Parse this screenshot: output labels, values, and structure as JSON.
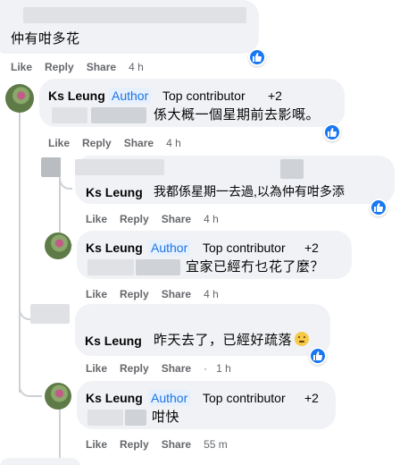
{
  "comment0": {
    "text": "仲有咁多花",
    "actions": {
      "like": "Like",
      "reply": "Reply",
      "share": "Share",
      "time": "4 h"
    }
  },
  "comment1": {
    "name": "Ks Leung",
    "author_badge": "Author",
    "contributor": "Top contributor",
    "plus": "+2",
    "text": "係大概一個星期前去影嘅。",
    "actions": {
      "like": "Like",
      "reply": "Reply",
      "share": "Share",
      "time": "4 h"
    }
  },
  "comment2": {
    "name": "Ks Leung",
    "text": "我都係星期一去過,以為仲有咁多添",
    "actions": {
      "like": "Like",
      "reply": "Reply",
      "share": "Share",
      "time": "4 h"
    }
  },
  "comment3": {
    "name": "Ks Leung",
    "author_badge": "Author",
    "contributor": "Top contributor",
    "plus": "+2",
    "text": "宜家已經冇乜花了麼？",
    "actions": {
      "like": "Like",
      "reply": "Reply",
      "share": "Share",
      "time": "4 h"
    }
  },
  "comment4": {
    "name": "Ks Leung",
    "text": "昨天去了，已經好疏落",
    "emoji": "worried-face-emoji",
    "actions": {
      "like": "Like",
      "reply": "Reply",
      "share": "Share",
      "separator": "·",
      "time": "1 h"
    }
  },
  "comment5": {
    "name": "Ks Leung",
    "author_badge": "Author",
    "contributor": "Top contributor",
    "plus": "+2",
    "text": "咁快",
    "actions": {
      "like": "Like",
      "reply": "Reply",
      "share": "Share",
      "time": "55 m"
    }
  },
  "colors": {
    "bubble": "#f0f2f5",
    "like_blue": "#1877f2",
    "author_blue": "#1b74e4",
    "meta_gray": "#65676b",
    "thread_line": "#ced0d4"
  }
}
